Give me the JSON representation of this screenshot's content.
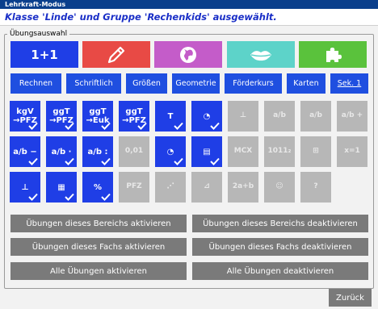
{
  "window": {
    "title": "Lehrkraft-Modus"
  },
  "header": {
    "selection_text": "Klasse 'Linde' und Gruppe 'Rechenkids' ausgewählt."
  },
  "section": {
    "legend": "Übungsauswahl"
  },
  "faecher": [
    {
      "name": "math",
      "label": "1+1",
      "color": "#1f3ee6",
      "icon": "one-plus-one"
    },
    {
      "name": "german",
      "label": "",
      "color": "#e84a45",
      "icon": "pencil"
    },
    {
      "name": "geography",
      "label": "",
      "color": "#c45cc9",
      "icon": "globe"
    },
    {
      "name": "language",
      "label": "",
      "color": "#5dd3c9",
      "icon": "lips"
    },
    {
      "name": "puzzle",
      "label": "",
      "color": "#5ac23c",
      "icon": "puzzle"
    }
  ],
  "categories": [
    {
      "label": "Rechnen",
      "active": false
    },
    {
      "label": "Schriftlich",
      "active": false
    },
    {
      "label": "Größen",
      "active": false
    },
    {
      "label": "Geometrie",
      "active": false
    },
    {
      "label": "Förderkurs",
      "active": false
    },
    {
      "label": "Karten",
      "active": false
    },
    {
      "label": "Sek. 1",
      "active": true
    }
  ],
  "exercises": [
    [
      {
        "text": "kgV →PFZ",
        "on": true,
        "checked": true
      },
      {
        "text": "ggT →PFZ",
        "on": true,
        "checked": true
      },
      {
        "text": "ggT →Euk",
        "on": true,
        "checked": true
      },
      {
        "text": "ggT →PFZ",
        "on": true,
        "checked": true
      },
      {
        "text": "T",
        "on": true,
        "checked": true
      },
      {
        "text": "◔",
        "on": true,
        "checked": true
      },
      {
        "text": "⊥",
        "on": false,
        "checked": false
      },
      {
        "text": "a/b",
        "on": false,
        "checked": false
      },
      {
        "text": "a/b",
        "on": false,
        "checked": false
      },
      {
        "text": "a/b +",
        "on": false,
        "checked": false
      }
    ],
    [
      {
        "text": "a/b −",
        "on": true,
        "checked": true
      },
      {
        "text": "a/b ·",
        "on": true,
        "checked": true
      },
      {
        "text": "a/b :",
        "on": true,
        "checked": true
      },
      {
        "text": "0,01",
        "on": false,
        "checked": false
      },
      {
        "text": "◔",
        "on": true,
        "checked": true
      },
      {
        "text": "▤",
        "on": true,
        "checked": true
      },
      {
        "text": "MCX",
        "on": false,
        "checked": false
      },
      {
        "text": "1011₂",
        "on": false,
        "checked": false
      },
      {
        "text": "⊞",
        "on": false,
        "checked": false
      },
      {
        "text": "x=1",
        "on": false,
        "checked": false
      }
    ],
    [
      {
        "text": "⊥",
        "on": true,
        "checked": true
      },
      {
        "text": "▦",
        "on": true,
        "checked": true
      },
      {
        "text": "%",
        "on": true,
        "checked": true
      },
      {
        "text": "PFZ",
        "on": false,
        "checked": false
      },
      {
        "text": "⋰",
        "on": false,
        "checked": false
      },
      {
        "text": "⊿",
        "on": false,
        "checked": false
      },
      {
        "text": "2a+b",
        "on": false,
        "checked": false
      },
      {
        "text": "☺",
        "on": false,
        "checked": false
      },
      {
        "text": "?",
        "on": false,
        "checked": false
      }
    ]
  ],
  "actions": {
    "bereich_aktivieren": "Übungen dieses Bereichs aktivieren",
    "bereich_deaktivieren": "Übungen dieses Bereichs deaktivieren",
    "fach_aktivieren": "Übungen dieses Fachs aktivieren",
    "fach_deaktivieren": "Übungen dieses Fachs deaktivieren",
    "alle_aktivieren": "Alle Übungen aktivieren",
    "alle_deaktivieren": "Alle Übungen deaktivieren"
  },
  "footer": {
    "back_label": "Zurück"
  }
}
